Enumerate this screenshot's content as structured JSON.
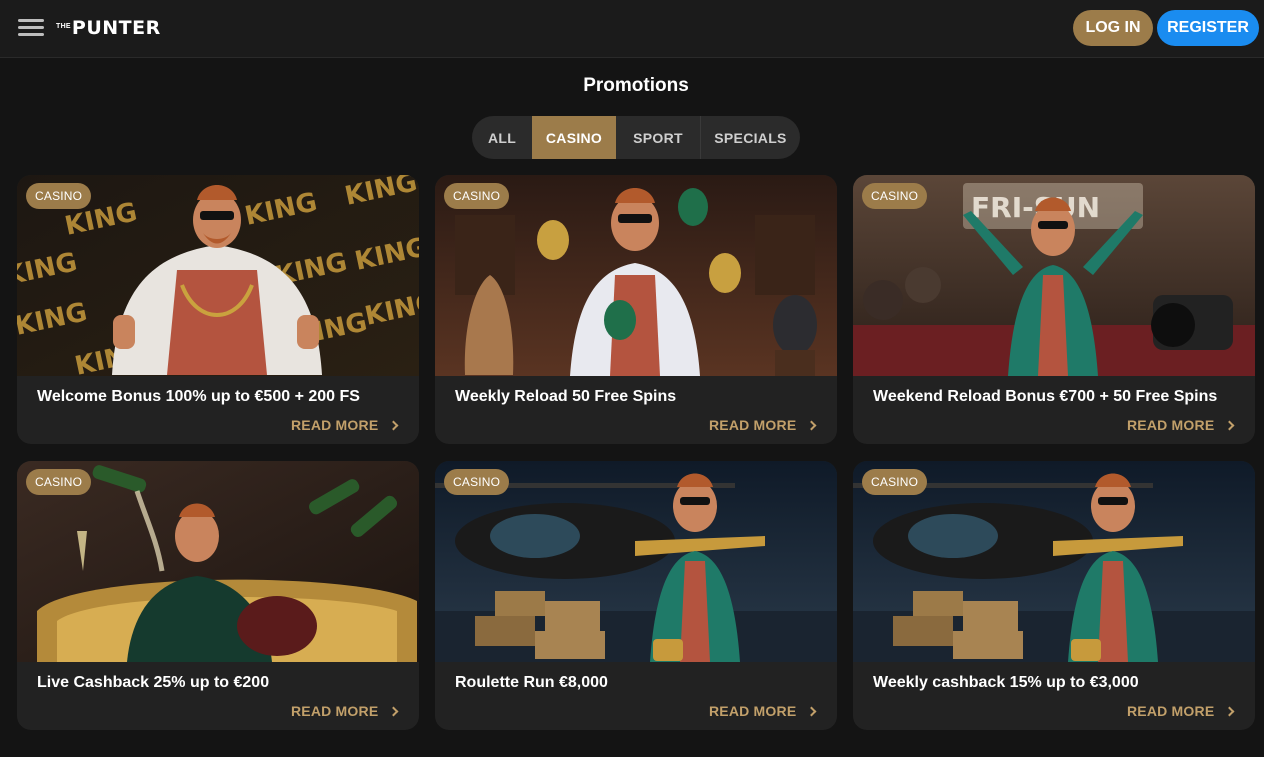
{
  "header": {
    "logo_prefix": "THE",
    "logo_text": "PUNTER",
    "login_label": "LOG IN",
    "register_label": "REGISTER"
  },
  "page_title": "Promotions",
  "tabs": [
    {
      "label": "ALL",
      "active": false
    },
    {
      "label": "CASINO",
      "active": true
    },
    {
      "label": "SPORT",
      "active": false
    },
    {
      "label": "SPECIALS",
      "active": false
    }
  ],
  "promotions": [
    {
      "badge": "CASINO",
      "title": "Welcome Bonus 100% up to €500 + 200 FS",
      "cta": "READ MORE",
      "image": "king-fur-coat-illustration"
    },
    {
      "badge": "CASINO",
      "title": "Weekly Reload 50 Free Spins",
      "cta": "READ MORE",
      "image": "juggling-eggs-museum-illustration"
    },
    {
      "badge": "CASINO",
      "title": "Weekend Reload Bonus €700 + 50 Free Spins",
      "cta": "READ MORE",
      "image": "red-carpet-paparazzi-illustration"
    },
    {
      "badge": "CASINO",
      "title": "Live Cashback 25% up to €200",
      "cta": "READ MORE",
      "image": "champagne-bathtub-illustration"
    },
    {
      "badge": "CASINO",
      "title": "Roulette Run €8,000",
      "cta": "READ MORE",
      "image": "helicopter-luggage-illustration"
    },
    {
      "badge": "CASINO",
      "title": "Weekly cashback 15% up to €3,000",
      "cta": "READ MORE",
      "image": "helicopter-luggage-illustration"
    }
  ],
  "colors": {
    "accent_gold": "#9c7c4a",
    "link_gold": "#c2a06a",
    "register_blue": "#1a8cf0",
    "background": "#141414",
    "card_background": "#222222"
  },
  "icons": {
    "menu": "hamburger-menu-icon",
    "read_more": "chevron-right-icon"
  }
}
